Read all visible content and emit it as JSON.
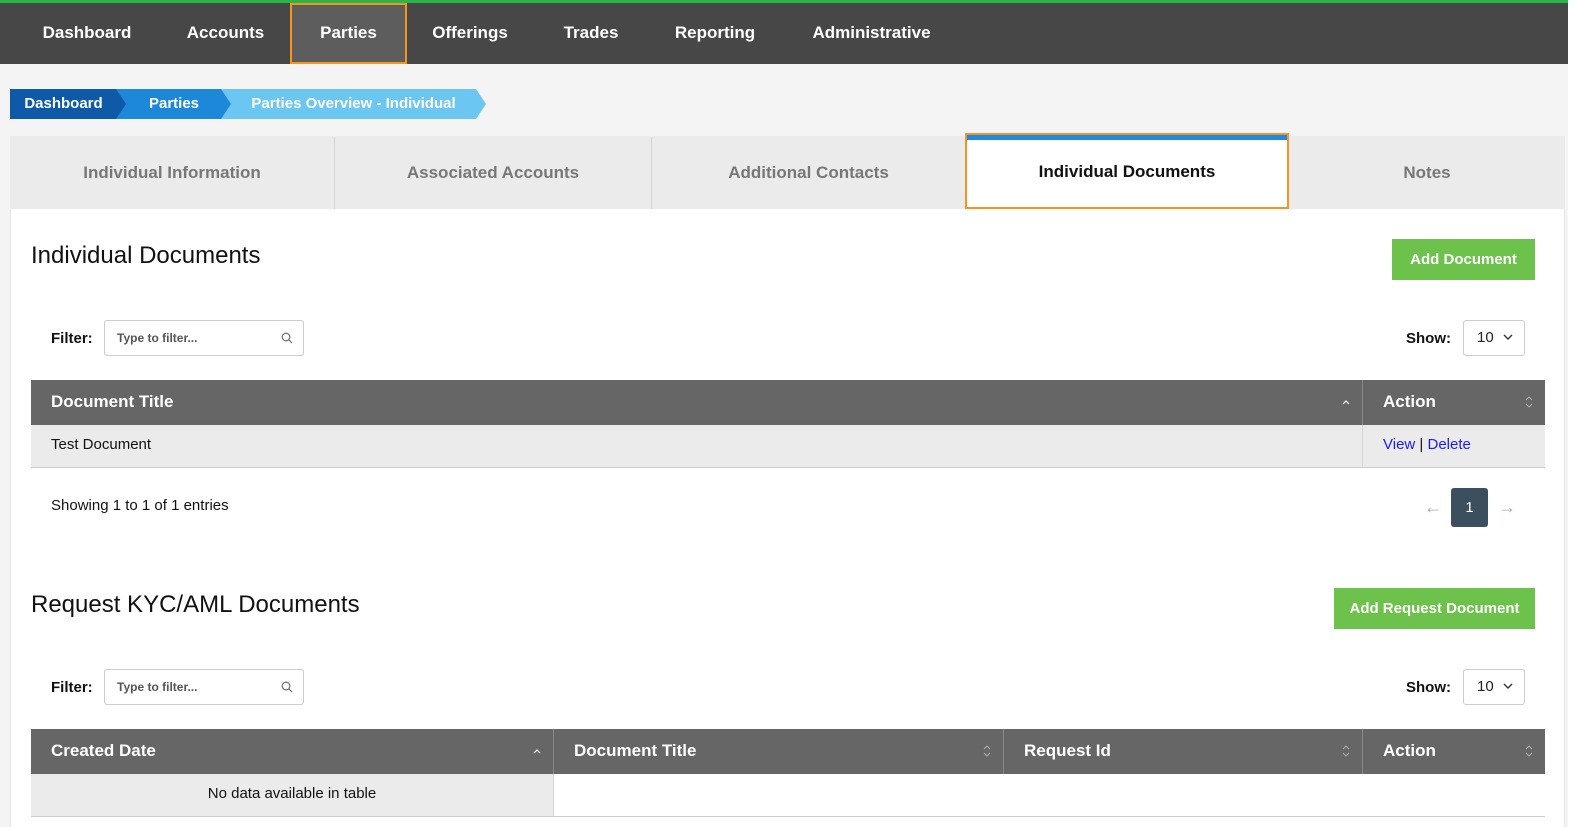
{
  "nav": {
    "items": [
      {
        "label": "Dashboard"
      },
      {
        "label": "Accounts"
      },
      {
        "label": "Parties"
      },
      {
        "label": "Offerings"
      },
      {
        "label": "Trades"
      },
      {
        "label": "Reporting"
      },
      {
        "label": "Administrative"
      }
    ],
    "active": "Parties"
  },
  "breadcrumb": [
    {
      "label": "Dashboard",
      "color": "#0f5aa8"
    },
    {
      "label": "Parties",
      "color": "#1e88d8"
    },
    {
      "label": "Parties Overview - Individual",
      "color": "#6cc6f2"
    }
  ],
  "tabs": [
    {
      "label": "Individual Information"
    },
    {
      "label": "Associated Accounts"
    },
    {
      "label": "Additional Contacts"
    },
    {
      "label": "Individual Documents"
    },
    {
      "label": "Notes"
    }
  ],
  "active_tab": "Individual Documents",
  "documents": {
    "title": "Individual Documents",
    "add_button": "Add Document",
    "filter_label": "Filter:",
    "filter_placeholder": "Type to filter...",
    "show_label": "Show:",
    "show_value": "10",
    "columns": [
      "Document Title",
      "Action"
    ],
    "rows": [
      {
        "title": "Test Document",
        "view": "View",
        "sep": "|",
        "delete": "Delete"
      }
    ],
    "info": "Showing 1 to 1 of 1 entries",
    "page": "1",
    "prev_arrow": "←",
    "next_arrow": "→"
  },
  "kyc": {
    "title": "Request KYC/AML Documents",
    "add_button": "Add Request Document",
    "filter_label": "Filter:",
    "filter_placeholder": "Type to filter...",
    "show_label": "Show:",
    "show_value": "10",
    "columns": [
      "Created Date",
      "Document Title",
      "Request Id",
      "Action"
    ],
    "empty": "No data available in table"
  },
  "colors": {
    "nav_bg": "#474747",
    "nav_top_accent": "#2ab54b",
    "highlight": "#f7941d",
    "green_button": "#6cc24a",
    "table_header": "#666666",
    "link": "#1a1aff",
    "pager": "#3c4f5e"
  }
}
